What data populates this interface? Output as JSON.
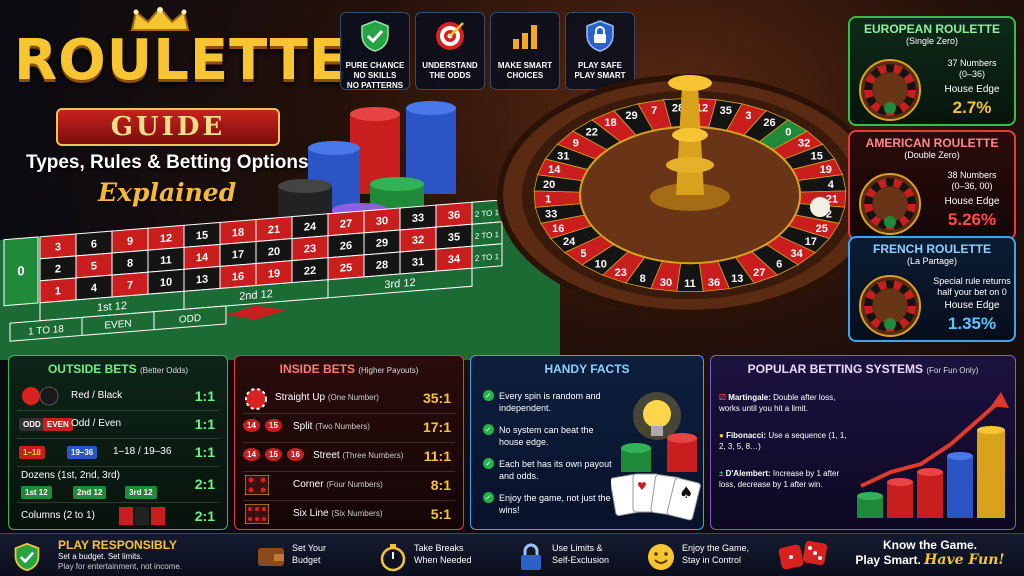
{
  "header": {
    "title": "ROULETTE",
    "badge": "GUIDE",
    "subtitle": "Types, Rules & Betting Options",
    "tagline": "Explained"
  },
  "top_icons": [
    {
      "icon": "shield-check-icon",
      "line1": "PURE CHANCE",
      "line2": "NO SKILLS",
      "line3": "NO PATTERNS"
    },
    {
      "icon": "target-icon",
      "line1": "UNDERSTAND",
      "line2": "THE ODDS",
      "line3": ""
    },
    {
      "icon": "bar-chart-icon",
      "line1": "MAKE SMART",
      "line2": "CHOICES",
      "line3": ""
    },
    {
      "icon": "lock-shield-icon",
      "line1": "PLAY SAFE",
      "line2": "PLAY SMART",
      "line3": ""
    }
  ],
  "table": {
    "zero": "0",
    "rows": [
      [
        "3",
        "6",
        "9",
        "12",
        "15",
        "18",
        "21",
        "24",
        "27",
        "30",
        "33",
        "36"
      ],
      [
        "2",
        "5",
        "8",
        "11",
        "14",
        "17",
        "20",
        "23",
        "26",
        "29",
        "32",
        "35"
      ],
      [
        "1",
        "4",
        "7",
        "10",
        "13",
        "16",
        "19",
        "22",
        "25",
        "28",
        "31",
        "34"
      ]
    ],
    "red_numbers": [
      "1",
      "3",
      "5",
      "7",
      "9",
      "12",
      "14",
      "16",
      "18",
      "19",
      "21",
      "23",
      "25",
      "27",
      "30",
      "32",
      "34",
      "36"
    ],
    "dozens": [
      "1st 12",
      "2nd 12",
      "3rd 12"
    ],
    "outside": [
      "1 TO 18",
      "EVEN",
      "ODD"
    ],
    "column_label": "2 TO 1"
  },
  "wheel_numbers": [
    "12",
    "35",
    "3",
    "26",
    "0",
    "32",
    "15",
    "19",
    "4",
    "21",
    "2",
    "25",
    "17",
    "34",
    "6",
    "27",
    "13",
    "36",
    "11",
    "30",
    "8",
    "23",
    "10",
    "5",
    "24",
    "16",
    "33",
    "1",
    "20",
    "14",
    "31",
    "9",
    "22",
    "18",
    "29",
    "7",
    "28"
  ],
  "variants": [
    {
      "name": "EUROPEAN ROULETTE",
      "sub": "(Single Zero)",
      "numbers": "37 Numbers",
      "range": "(0–36)",
      "edge_label": "House Edge",
      "edge": "2.7%",
      "accent": "#2fbf4a"
    },
    {
      "name": "AMERICAN ROULETTE",
      "sub": "(Double Zero)",
      "numbers": "38 Numbers",
      "range": "(0–36, 00)",
      "edge_label": "House Edge",
      "edge": "5.26%",
      "accent": "#e53b3b"
    },
    {
      "name": "FRENCH ROULETTE",
      "sub": "(La Partage)",
      "numbers": "Special rule returns",
      "range": "half your bet on 0",
      "edge_label": "House Edge",
      "edge": "1.35%",
      "accent": "#3aa6f0"
    }
  ],
  "outside_bets": {
    "title": "OUTSIDE BETS",
    "note": "(Better Odds)",
    "rows": [
      {
        "label": "Red / Black",
        "odds": "1:1"
      },
      {
        "label": "Odd / Even",
        "odds": "1:1",
        "chip1": "ODD",
        "chip2": "EVEN"
      },
      {
        "label": "1–18 / 19–36",
        "odds": "1:1",
        "chip1": "1–18",
        "chip2": "19–36"
      },
      {
        "label": "Dozens (1st, 2nd, 3rd)",
        "odds": "2:1",
        "chips": [
          "1st 12",
          "2nd 12",
          "3rd 12"
        ]
      },
      {
        "label": "Columns (2 to 1)",
        "odds": "2:1"
      }
    ]
  },
  "inside_bets": {
    "title": "INSIDE BETS",
    "note": "(Higher Payouts)",
    "rows": [
      {
        "label": "Straight Up",
        "detail": "(One Number)",
        "odds": "35:1"
      },
      {
        "label": "Split",
        "detail": "(Two Numbers)",
        "odds": "17:1",
        "chips": [
          "14",
          "15"
        ]
      },
      {
        "label": "Street",
        "detail": "(Three Numbers)",
        "odds": "11:1",
        "chips": [
          "14",
          "15",
          "16"
        ]
      },
      {
        "label": "Corner",
        "detail": "(Four Numbers)",
        "odds": "8:1"
      },
      {
        "label": "Six Line",
        "detail": "(Six Numbers)",
        "odds": "5:1"
      }
    ]
  },
  "handy_facts": {
    "title": "HANDY FACTS",
    "items": [
      "Every spin is random and independent.",
      "No system can beat the house edge.",
      "Each bet has its own payout and odds.",
      "Enjoy the game, not just the wins!"
    ]
  },
  "systems": {
    "title": "POPULAR BETTING SYSTEMS",
    "note": "(For Fun Only)",
    "items": [
      {
        "name": "Martingale:",
        "text": "Double after loss, works until you hit a limit."
      },
      {
        "name": "Fibonacci:",
        "text": "Use a sequence (1, 1, 2, 3, 5, 8…)"
      },
      {
        "name": "D'Alembert:",
        "text": "Increase by 1 after loss, decrease by 1 after win."
      }
    ]
  },
  "footer": {
    "responsibly_title": "PLAY RESPONSIBLY",
    "responsibly_line1": "Set a budget. Set limits.",
    "responsibly_line2": "Play for entertainment, not income.",
    "items": [
      {
        "icon": "wallet-icon",
        "line1": "Set Your",
        "line2": "Budget"
      },
      {
        "icon": "stopwatch-icon",
        "line1": "Take Breaks",
        "line2": "When Needed"
      },
      {
        "icon": "lock-icon",
        "line1": "Use Limits &",
        "line2": "Self-Exclusion"
      },
      {
        "icon": "smiley-icon",
        "line1": "Enjoy the Game,",
        "line2": "Stay in Control"
      }
    ],
    "closing_line1": "Know the Game.",
    "closing_line2": "Play Smart.",
    "closing_fun": "Have Fun!"
  },
  "colors": {
    "gold": "#f6c531",
    "red": "#d8221f",
    "green": "#1f8a3a",
    "blue": "#3aa6f0",
    "purple": "#6a4bc7"
  }
}
